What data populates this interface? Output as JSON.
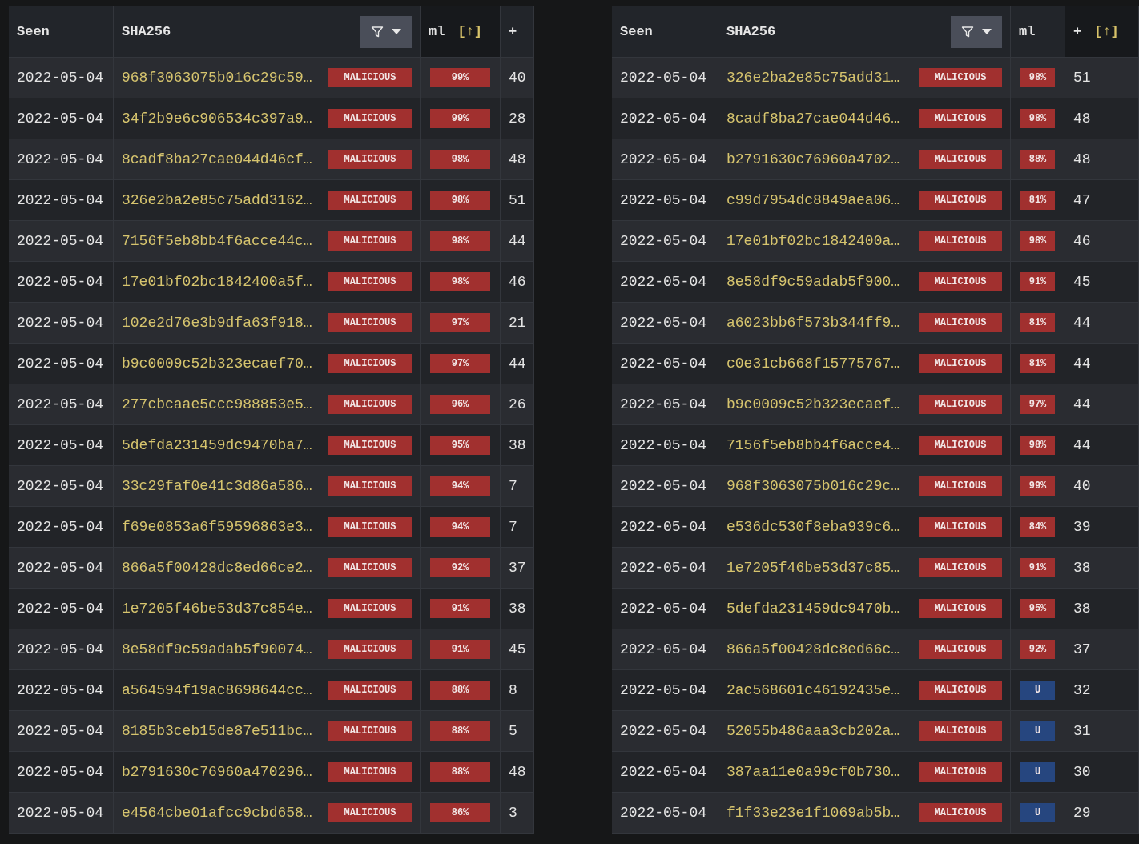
{
  "tables": [
    {
      "columns": [
        {
          "label": "Seen",
          "sorted": false,
          "filter": false
        },
        {
          "label": "SHA256",
          "sorted": false,
          "filter": true
        },
        {
          "label": "ml",
          "sorted": true,
          "sort_indicator": "[↑]",
          "filter": false
        },
        {
          "label": "+",
          "sorted": false,
          "filter": false
        }
      ],
      "rows": [
        {
          "seen": "2022-05-04",
          "sha256": "968f3063075b016c29c59…",
          "verdict": "MALICIOUS",
          "ml": {
            "kind": "score",
            "text": "99%"
          },
          "count": "40"
        },
        {
          "seen": "2022-05-04",
          "sha256": "34f2b9e6c906534c397a9…",
          "verdict": "MALICIOUS",
          "ml": {
            "kind": "score",
            "text": "99%"
          },
          "count": "28"
        },
        {
          "seen": "2022-05-04",
          "sha256": "8cadf8ba27cae044d46cf…",
          "verdict": "MALICIOUS",
          "ml": {
            "kind": "score",
            "text": "98%"
          },
          "count": "48"
        },
        {
          "seen": "2022-05-04",
          "sha256": "326e2ba2e85c75add3162…",
          "verdict": "MALICIOUS",
          "ml": {
            "kind": "score",
            "text": "98%"
          },
          "count": "51"
        },
        {
          "seen": "2022-05-04",
          "sha256": "7156f5eb8bb4f6acce44c…",
          "verdict": "MALICIOUS",
          "ml": {
            "kind": "score",
            "text": "98%"
          },
          "count": "44"
        },
        {
          "seen": "2022-05-04",
          "sha256": "17e01bf02bc1842400a5f…",
          "verdict": "MALICIOUS",
          "ml": {
            "kind": "score",
            "text": "98%"
          },
          "count": "46"
        },
        {
          "seen": "2022-05-04",
          "sha256": "102e2d76e3b9dfa63f918…",
          "verdict": "MALICIOUS",
          "ml": {
            "kind": "score",
            "text": "97%"
          },
          "count": "21"
        },
        {
          "seen": "2022-05-04",
          "sha256": "b9c0009c52b323ecaef70…",
          "verdict": "MALICIOUS",
          "ml": {
            "kind": "score",
            "text": "97%"
          },
          "count": "44"
        },
        {
          "seen": "2022-05-04",
          "sha256": "277cbcaae5ccc988853e5…",
          "verdict": "MALICIOUS",
          "ml": {
            "kind": "score",
            "text": "96%"
          },
          "count": "26"
        },
        {
          "seen": "2022-05-04",
          "sha256": "5defda231459dc9470ba7…",
          "verdict": "MALICIOUS",
          "ml": {
            "kind": "score",
            "text": "95%"
          },
          "count": "38"
        },
        {
          "seen": "2022-05-04",
          "sha256": "33c29faf0e41c3d86a586…",
          "verdict": "MALICIOUS",
          "ml": {
            "kind": "score",
            "text": "94%"
          },
          "count": "7"
        },
        {
          "seen": "2022-05-04",
          "sha256": "f69e0853a6f59596863e3…",
          "verdict": "MALICIOUS",
          "ml": {
            "kind": "score",
            "text": "94%"
          },
          "count": "7"
        },
        {
          "seen": "2022-05-04",
          "sha256": "866a5f00428dc8ed66ce2…",
          "verdict": "MALICIOUS",
          "ml": {
            "kind": "score",
            "text": "92%"
          },
          "count": "37"
        },
        {
          "seen": "2022-05-04",
          "sha256": "1e7205f46be53d37c854e…",
          "verdict": "MALICIOUS",
          "ml": {
            "kind": "score",
            "text": "91%"
          },
          "count": "38"
        },
        {
          "seen": "2022-05-04",
          "sha256": "8e58df9c59adab5f90074…",
          "verdict": "MALICIOUS",
          "ml": {
            "kind": "score",
            "text": "91%"
          },
          "count": "45"
        },
        {
          "seen": "2022-05-04",
          "sha256": "a564594f19ac8698644cc…",
          "verdict": "MALICIOUS",
          "ml": {
            "kind": "score",
            "text": "88%"
          },
          "count": "8"
        },
        {
          "seen": "2022-05-04",
          "sha256": "8185b3ceb15de87e511bc…",
          "verdict": "MALICIOUS",
          "ml": {
            "kind": "score",
            "text": "88%"
          },
          "count": "5"
        },
        {
          "seen": "2022-05-04",
          "sha256": "b2791630c76960a470296…",
          "verdict": "MALICIOUS",
          "ml": {
            "kind": "score",
            "text": "88%"
          },
          "count": "48"
        },
        {
          "seen": "2022-05-04",
          "sha256": "e4564cbe01afcc9cbd658…",
          "verdict": "MALICIOUS",
          "ml": {
            "kind": "score",
            "text": "86%"
          },
          "count": "3"
        }
      ]
    },
    {
      "columns": [
        {
          "label": "Seen",
          "sorted": false,
          "filter": false
        },
        {
          "label": "SHA256",
          "sorted": false,
          "filter": true
        },
        {
          "label": "ml",
          "sorted": false,
          "filter": false
        },
        {
          "label": "+",
          "sorted": true,
          "sort_indicator": "[↑]",
          "filter": false
        }
      ],
      "rows": [
        {
          "seen": "2022-05-04",
          "sha256": "326e2ba2e85c75add31…",
          "verdict": "MALICIOUS",
          "ml": {
            "kind": "score",
            "text": "98%"
          },
          "count": "51"
        },
        {
          "seen": "2022-05-04",
          "sha256": "8cadf8ba27cae044d46…",
          "verdict": "MALICIOUS",
          "ml": {
            "kind": "score",
            "text": "98%"
          },
          "count": "48"
        },
        {
          "seen": "2022-05-04",
          "sha256": "b2791630c76960a4702…",
          "verdict": "MALICIOUS",
          "ml": {
            "kind": "score",
            "text": "88%"
          },
          "count": "48"
        },
        {
          "seen": "2022-05-04",
          "sha256": "c99d7954dc8849aea06…",
          "verdict": "MALICIOUS",
          "ml": {
            "kind": "score",
            "text": "81%"
          },
          "count": "47"
        },
        {
          "seen": "2022-05-04",
          "sha256": "17e01bf02bc1842400a…",
          "verdict": "MALICIOUS",
          "ml": {
            "kind": "score",
            "text": "98%"
          },
          "count": "46"
        },
        {
          "seen": "2022-05-04",
          "sha256": "8e58df9c59adab5f900…",
          "verdict": "MALICIOUS",
          "ml": {
            "kind": "score",
            "text": "91%"
          },
          "count": "45"
        },
        {
          "seen": "2022-05-04",
          "sha256": "a6023bb6f573b344ff9…",
          "verdict": "MALICIOUS",
          "ml": {
            "kind": "score",
            "text": "81%"
          },
          "count": "44"
        },
        {
          "seen": "2022-05-04",
          "sha256": "c0e31cb668f15775767…",
          "verdict": "MALICIOUS",
          "ml": {
            "kind": "score",
            "text": "81%"
          },
          "count": "44"
        },
        {
          "seen": "2022-05-04",
          "sha256": "b9c0009c52b323ecaef…",
          "verdict": "MALICIOUS",
          "ml": {
            "kind": "score",
            "text": "97%"
          },
          "count": "44"
        },
        {
          "seen": "2022-05-04",
          "sha256": "7156f5eb8bb4f6acce4…",
          "verdict": "MALICIOUS",
          "ml": {
            "kind": "score",
            "text": "98%"
          },
          "count": "44"
        },
        {
          "seen": "2022-05-04",
          "sha256": "968f3063075b016c29c…",
          "verdict": "MALICIOUS",
          "ml": {
            "kind": "score",
            "text": "99%"
          },
          "count": "40"
        },
        {
          "seen": "2022-05-04",
          "sha256": "e536dc530f8eba939c6…",
          "verdict": "MALICIOUS",
          "ml": {
            "kind": "score",
            "text": "84%"
          },
          "count": "39"
        },
        {
          "seen": "2022-05-04",
          "sha256": "1e7205f46be53d37c85…",
          "verdict": "MALICIOUS",
          "ml": {
            "kind": "score",
            "text": "91%"
          },
          "count": "38"
        },
        {
          "seen": "2022-05-04",
          "sha256": "5defda231459dc9470b…",
          "verdict": "MALICIOUS",
          "ml": {
            "kind": "score",
            "text": "95%"
          },
          "count": "38"
        },
        {
          "seen": "2022-05-04",
          "sha256": "866a5f00428dc8ed66c…",
          "verdict": "MALICIOUS",
          "ml": {
            "kind": "score",
            "text": "92%"
          },
          "count": "37"
        },
        {
          "seen": "2022-05-04",
          "sha256": "2ac568601c46192435e…",
          "verdict": "MALICIOUS",
          "ml": {
            "kind": "unknown",
            "text": "U"
          },
          "count": "32"
        },
        {
          "seen": "2022-05-04",
          "sha256": "52055b486aaa3cb202a…",
          "verdict": "MALICIOUS",
          "ml": {
            "kind": "unknown",
            "text": "U"
          },
          "count": "31"
        },
        {
          "seen": "2022-05-04",
          "sha256": "387aa11e0a99cf0b730…",
          "verdict": "MALICIOUS",
          "ml": {
            "kind": "unknown",
            "text": "U"
          },
          "count": "30"
        },
        {
          "seen": "2022-05-04",
          "sha256": "f1f33e23e1f1069ab5b…",
          "verdict": "MALICIOUS",
          "ml": {
            "kind": "unknown",
            "text": "U"
          },
          "count": "29"
        }
      ]
    }
  ]
}
